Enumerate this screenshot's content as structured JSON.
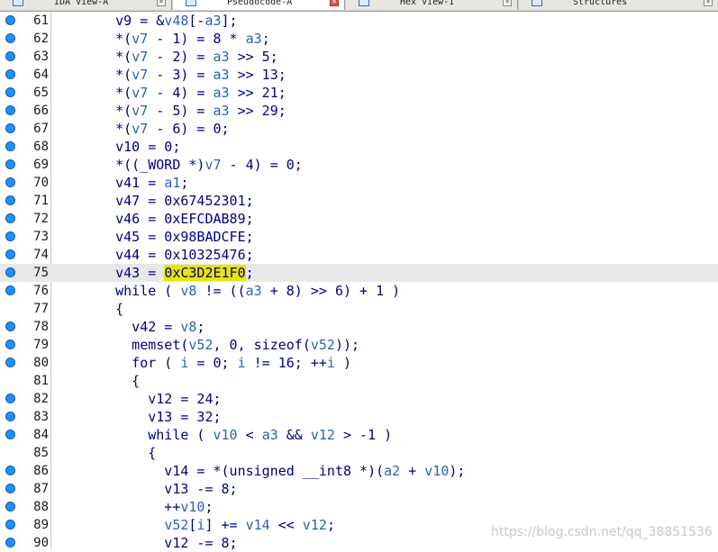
{
  "tabs": [
    {
      "label": "IDA View-A",
      "active": false,
      "close_label": "×"
    },
    {
      "label": "Pseudocode-A",
      "active": true,
      "close_label": "×"
    },
    {
      "label": "Hex View-1",
      "active": false,
      "close_label": "×"
    },
    {
      "label": "Structures",
      "active": false,
      "close_label": "×"
    }
  ],
  "lines": [
    {
      "num": "61",
      "bp": true,
      "segs": [
        {
          "t": "    v9 = &"
        },
        {
          "t": "v48",
          "k": "v"
        },
        {
          "t": "[-"
        },
        {
          "t": "a3",
          "k": "v"
        },
        {
          "t": "];"
        }
      ]
    },
    {
      "num": "62",
      "bp": true,
      "segs": [
        {
          "t": "    *("
        },
        {
          "t": "v7",
          "k": "v"
        },
        {
          "t": " - 1) = 8 * "
        },
        {
          "t": "a3",
          "k": "v"
        },
        {
          "t": ";"
        }
      ]
    },
    {
      "num": "63",
      "bp": true,
      "segs": [
        {
          "t": "    *("
        },
        {
          "t": "v7",
          "k": "v"
        },
        {
          "t": " - 2) = "
        },
        {
          "t": "a3",
          "k": "v"
        },
        {
          "t": " >> 5;"
        }
      ]
    },
    {
      "num": "64",
      "bp": true,
      "segs": [
        {
          "t": "    *("
        },
        {
          "t": "v7",
          "k": "v"
        },
        {
          "t": " - 3) = "
        },
        {
          "t": "a3",
          "k": "v"
        },
        {
          "t": " >> 13;"
        }
      ]
    },
    {
      "num": "65",
      "bp": true,
      "segs": [
        {
          "t": "    *("
        },
        {
          "t": "v7",
          "k": "v"
        },
        {
          "t": " - 4) = "
        },
        {
          "t": "a3",
          "k": "v"
        },
        {
          "t": " >> 21;"
        }
      ]
    },
    {
      "num": "66",
      "bp": true,
      "segs": [
        {
          "t": "    *("
        },
        {
          "t": "v7",
          "k": "v"
        },
        {
          "t": " - 5) = "
        },
        {
          "t": "a3",
          "k": "v"
        },
        {
          "t": " >> 29;"
        }
      ]
    },
    {
      "num": "67",
      "bp": true,
      "segs": [
        {
          "t": "    *("
        },
        {
          "t": "v7",
          "k": "v"
        },
        {
          "t": " - 6) = 0;"
        }
      ]
    },
    {
      "num": "68",
      "bp": true,
      "segs": [
        {
          "t": "    v10 = 0;"
        }
      ]
    },
    {
      "num": "69",
      "bp": true,
      "segs": [
        {
          "t": "    *((_WORD *)"
        },
        {
          "t": "v7",
          "k": "v"
        },
        {
          "t": " - 4) = 0;"
        }
      ]
    },
    {
      "num": "70",
      "bp": true,
      "segs": [
        {
          "t": "    v41 = "
        },
        {
          "t": "a1",
          "k": "v"
        },
        {
          "t": ";"
        }
      ]
    },
    {
      "num": "71",
      "bp": true,
      "segs": [
        {
          "t": "    v47 = 0x67452301;"
        }
      ]
    },
    {
      "num": "72",
      "bp": true,
      "segs": [
        {
          "t": "    v46 = 0xEFCDAB89;"
        }
      ]
    },
    {
      "num": "73",
      "bp": true,
      "segs": [
        {
          "t": "    v45 = 0x98BADCFE;"
        }
      ]
    },
    {
      "num": "74",
      "bp": true,
      "segs": [
        {
          "t": "    v44 = 0x10325476;"
        }
      ]
    },
    {
      "num": "75",
      "bp": true,
      "hl": true,
      "segs": [
        {
          "t": "    v43 = "
        },
        {
          "t": "0xC3D2E1F0",
          "k": "mark"
        },
        {
          "t": ";"
        }
      ]
    },
    {
      "num": "76",
      "bp": true,
      "segs": [
        {
          "t": "    while ( "
        },
        {
          "t": "v8",
          "k": "v"
        },
        {
          "t": " != (("
        },
        {
          "t": "a3",
          "k": "v"
        },
        {
          "t": " + 8) >> 6) + 1 )"
        }
      ]
    },
    {
      "num": "77",
      "bp": false,
      "segs": [
        {
          "t": "    {"
        }
      ]
    },
    {
      "num": "78",
      "bp": true,
      "segs": [
        {
          "t": "      v42 = "
        },
        {
          "t": "v8",
          "k": "v"
        },
        {
          "t": ";"
        }
      ]
    },
    {
      "num": "79",
      "bp": true,
      "segs": [
        {
          "t": "      memset("
        },
        {
          "t": "v52",
          "k": "v"
        },
        {
          "t": ", 0, sizeof("
        },
        {
          "t": "v52",
          "k": "v"
        },
        {
          "t": "));"
        }
      ]
    },
    {
      "num": "80",
      "bp": true,
      "segs": [
        {
          "t": "      for ( "
        },
        {
          "t": "i",
          "k": "v"
        },
        {
          "t": " = 0; "
        },
        {
          "t": "i",
          "k": "v"
        },
        {
          "t": " != 16; ++"
        },
        {
          "t": "i",
          "k": "v"
        },
        {
          "t": " )"
        }
      ]
    },
    {
      "num": "81",
      "bp": false,
      "segs": [
        {
          "t": "      {"
        }
      ]
    },
    {
      "num": "82",
      "bp": true,
      "segs": [
        {
          "t": "        v12 = 24;"
        }
      ]
    },
    {
      "num": "83",
      "bp": true,
      "segs": [
        {
          "t": "        v13 = 32;"
        }
      ]
    },
    {
      "num": "84",
      "bp": true,
      "segs": [
        {
          "t": "        while ( "
        },
        {
          "t": "v10",
          "k": "v"
        },
        {
          "t": " < "
        },
        {
          "t": "a3",
          "k": "v"
        },
        {
          "t": " && "
        },
        {
          "t": "v12",
          "k": "v"
        },
        {
          "t": " > -1 )"
        }
      ]
    },
    {
      "num": "85",
      "bp": false,
      "segs": [
        {
          "t": "        {"
        }
      ]
    },
    {
      "num": "86",
      "bp": true,
      "segs": [
        {
          "t": "          v14 = *(unsigned __int8 *)("
        },
        {
          "t": "a2",
          "k": "v"
        },
        {
          "t": " + "
        },
        {
          "t": "v10",
          "k": "v"
        },
        {
          "t": ");"
        }
      ]
    },
    {
      "num": "87",
      "bp": true,
      "segs": [
        {
          "t": "          v13 -= 8;"
        }
      ]
    },
    {
      "num": "88",
      "bp": true,
      "segs": [
        {
          "t": "          ++"
        },
        {
          "t": "v10",
          "k": "v"
        },
        {
          "t": ";"
        }
      ]
    },
    {
      "num": "89",
      "bp": true,
      "segs": [
        {
          "t": "          "
        },
        {
          "t": "v52",
          "k": "v"
        },
        {
          "t": "["
        },
        {
          "t": "i",
          "k": "v"
        },
        {
          "t": "] += "
        },
        {
          "t": "v14",
          "k": "v"
        },
        {
          "t": " << "
        },
        {
          "t": "v12",
          "k": "v"
        },
        {
          "t": ";"
        }
      ]
    },
    {
      "num": "90",
      "bp": true,
      "segs": [
        {
          "t": "          v12 -= 8;"
        }
      ]
    }
  ],
  "watermark": "https://blog.csdn.net/qq_38851536"
}
